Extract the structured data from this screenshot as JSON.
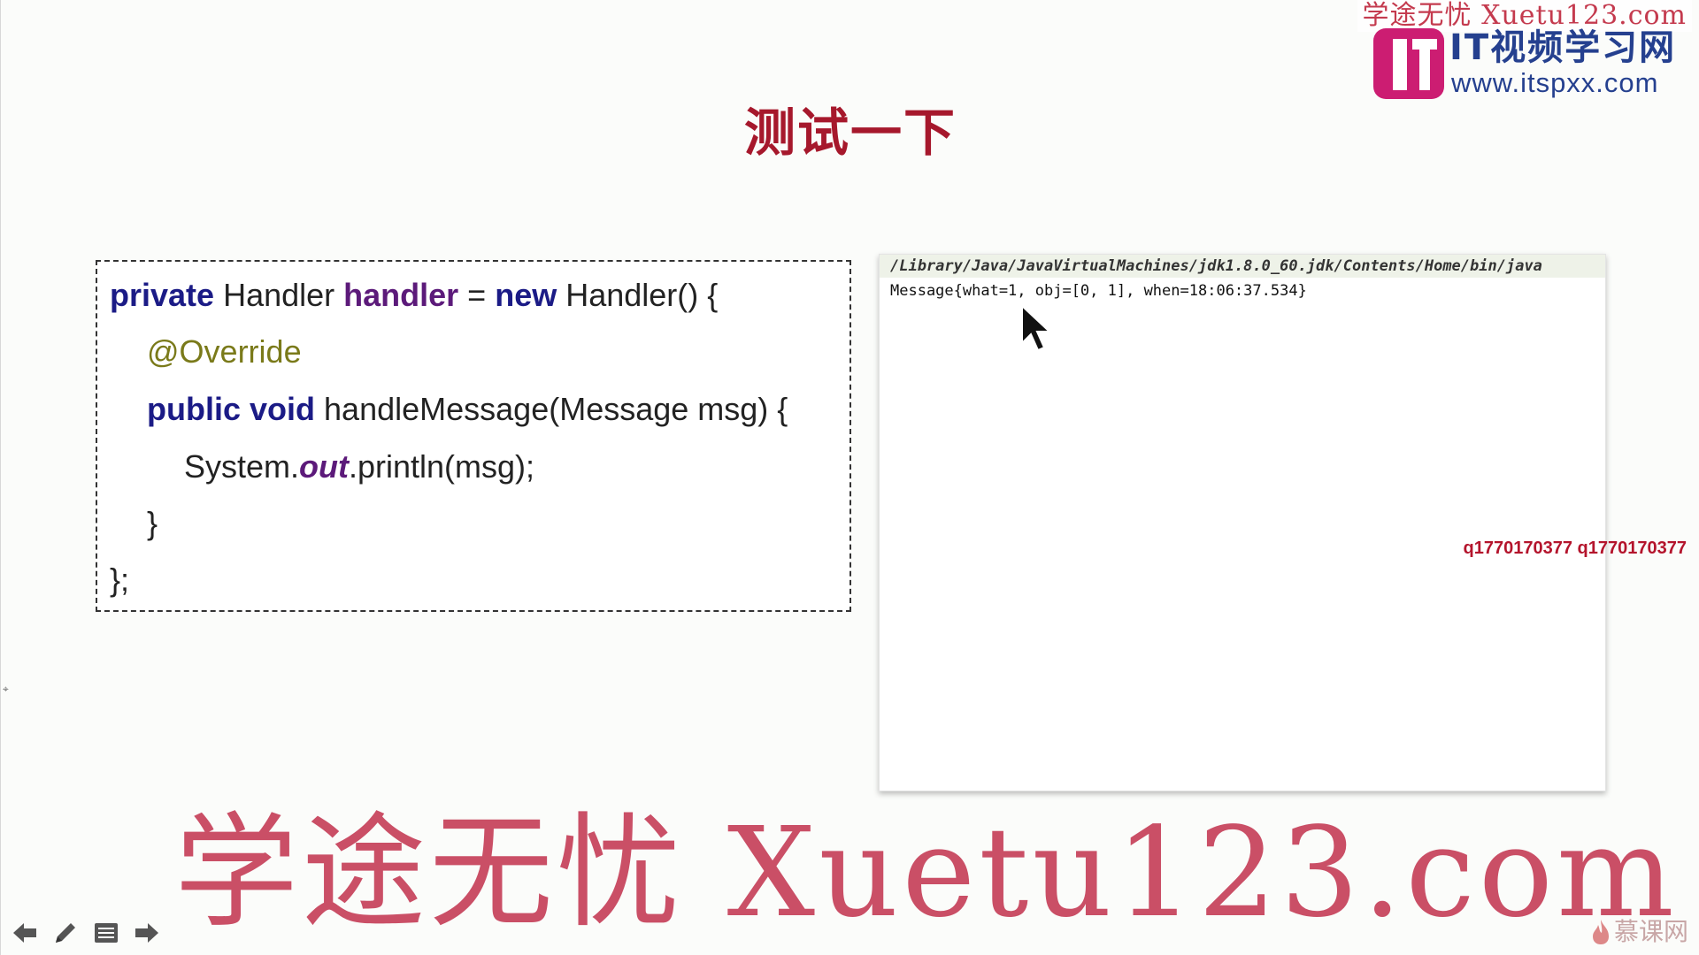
{
  "watermark": {
    "top_text": "学途无忧 Xuetu123.com",
    "big_text": "学途无忧 Xuetu123.com"
  },
  "logo": {
    "name": "IT视频学习网",
    "url": "www.itspxx.com"
  },
  "slide": {
    "title": "测试一下"
  },
  "code": {
    "line1": {
      "kw1": "private",
      "t1": " Handler ",
      "field": "handler",
      "t2": " = ",
      "kw2": "new",
      "t3": " Handler() {"
    },
    "line2": {
      "annotation": "@Override"
    },
    "line3": {
      "kw1": "public",
      "t1": " ",
      "kw2": "void",
      "t2": " handleMessage(Message msg) {"
    },
    "line4": {
      "t1": "System.",
      "static": "out",
      "t2": ".println(msg);"
    },
    "line5": "}",
    "line6": "};"
  },
  "console": {
    "path": "/Library/Java/JavaVirtualMachines/jdk1.8.0_60.jdk/Contents/Home/bin/java",
    "output": "Message{what=1, obj=[0, 1], when=18:06:37.534}"
  },
  "qq_watermark": "q1770170377 q1770170377",
  "imooc": {
    "label": "慕课网",
    "icon": "flame-icon"
  },
  "nav": {
    "icons": [
      "arrow-left-icon",
      "pencil-icon",
      "menu-icon",
      "arrow-right-icon"
    ]
  },
  "colors": {
    "title": "#a6182c",
    "keyword": "#1b1b86",
    "field": "#5c1a7a",
    "annotation": "#7a7a1a",
    "watermark": "#c43a4e",
    "logo_magenta": "#cc1d72",
    "logo_blue": "#25408f"
  }
}
